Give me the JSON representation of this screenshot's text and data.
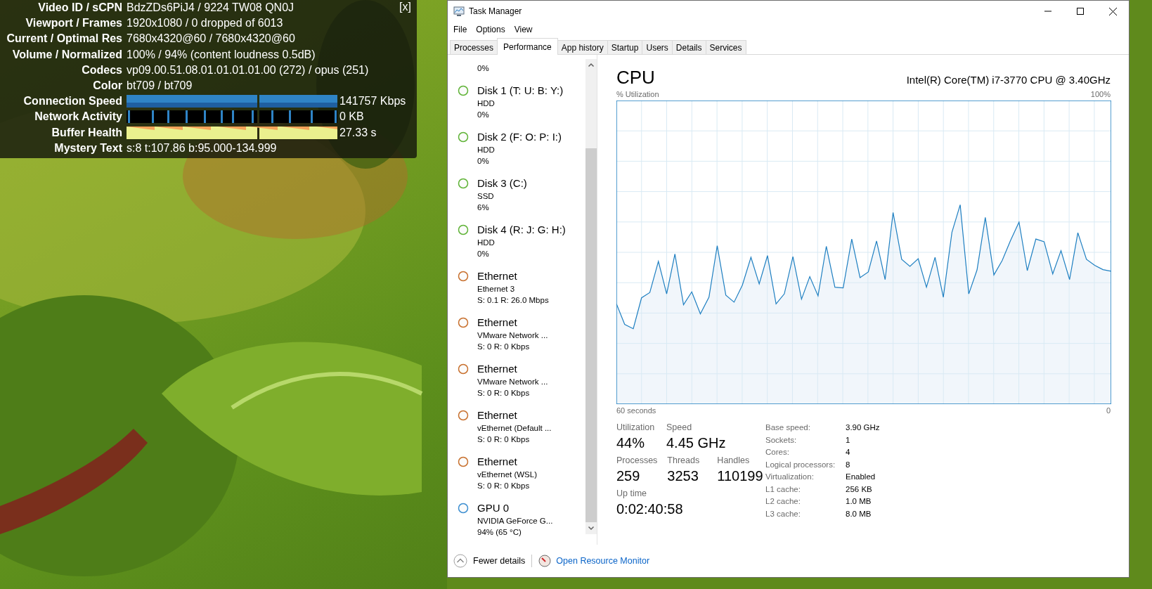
{
  "video_stats": {
    "close": "[x]",
    "rows": [
      {
        "label": "Video ID / sCPN",
        "kind": "text",
        "value": "BdzZDs6PiJ4 / 9224 TW08 QN0J"
      },
      {
        "label": "Viewport / Frames",
        "kind": "text",
        "value": "1920x1080 / 0 dropped of 6013"
      },
      {
        "label": "Current / Optimal Res",
        "kind": "text",
        "value": "7680x4320@60 / 7680x4320@60"
      },
      {
        "label": "Volume / Normalized",
        "kind": "text",
        "value": "100% / 94% (content loudness 0.5dB)"
      },
      {
        "label": "Codecs",
        "kind": "text",
        "value": "vp09.00.51.08.01.01.01.01.00 (272) / opus (251)"
      },
      {
        "label": "Color",
        "kind": "text",
        "value": "bt709 / bt709"
      },
      {
        "label": "Connection Speed",
        "kind": "speed_graph",
        "value": "141757 Kbps"
      },
      {
        "label": "Network Activity",
        "kind": "activity_graph",
        "value": "0 KB"
      },
      {
        "label": "Buffer Health",
        "kind": "buffer_graph",
        "value": "27.33 s"
      },
      {
        "label": "Mystery Text",
        "kind": "text",
        "value": "s:8 t:107.86 b:95.000-134.999"
      }
    ]
  },
  "window": {
    "title": "Task Manager"
  },
  "menu": [
    "File",
    "Options",
    "View"
  ],
  "tabs": [
    {
      "label": "Processes",
      "selected": false
    },
    {
      "label": "Performance",
      "selected": true
    },
    {
      "label": "App history",
      "selected": false
    },
    {
      "label": "Startup",
      "selected": false
    },
    {
      "label": "Users",
      "selected": false
    },
    {
      "label": "Details",
      "selected": false
    },
    {
      "label": "Services",
      "selected": false
    }
  ],
  "sidebar": {
    "items": [
      {
        "detail": "0%"
      },
      {
        "title": "Disk 1 (T: U: B: Y:)",
        "subtitle": "HDD",
        "detail": "0%",
        "color": "#5fb336"
      },
      {
        "title": "Disk 2 (F: O: P: I:)",
        "subtitle": "HDD",
        "detail": "0%",
        "color": "#5fb336"
      },
      {
        "title": "Disk 3 (C:)",
        "subtitle": "SSD",
        "detail": "6%",
        "color": "#5fb336"
      },
      {
        "title": "Disk 4 (R: J: G: H:)",
        "subtitle": "HDD",
        "detail": "0%",
        "color": "#5fb336"
      },
      {
        "title": "Ethernet",
        "subtitle": "Ethernet 3",
        "detail": "S: 0.1 R: 26.0 Mbps",
        "color": "#c8702e"
      },
      {
        "title": "Ethernet",
        "subtitle": "VMware Network ...",
        "detail": "S: 0 R: 0 Kbps",
        "color": "#c8702e"
      },
      {
        "title": "Ethernet",
        "subtitle": "VMware Network ...",
        "detail": "S: 0 R: 0 Kbps",
        "color": "#c8702e"
      },
      {
        "title": "Ethernet",
        "subtitle": "vEthernet (Default ...",
        "detail": "S: 0 R: 0 Kbps",
        "color": "#c8702e"
      },
      {
        "title": "Ethernet",
        "subtitle": "vEthernet (WSL)",
        "detail": "S: 0 R: 0 Kbps",
        "color": "#c8702e"
      },
      {
        "title": "GPU 0",
        "subtitle": "NVIDIA GeForce G...",
        "detail": "94%  (65 °C)",
        "color": "#3d8fd1"
      }
    ]
  },
  "performance": {
    "title": "CPU",
    "model": "Intel(R) Core(TM) i7-3770 CPU @ 3.40GHz",
    "graph": {
      "y_label": "% Utilization",
      "y_max": "100%",
      "x_start": "60 seconds",
      "x_end": "0"
    },
    "stat_rows": [
      [
        {
          "label": "Utilization",
          "value": "44%"
        },
        {
          "label": "Speed",
          "value": "4.45 GHz"
        }
      ],
      [
        {
          "label": "Processes",
          "value": "259"
        },
        {
          "label": "Threads",
          "value": "3253"
        },
        {
          "label": "Handles",
          "value": "110199"
        }
      ],
      [
        {
          "label": "Up time",
          "value": "0:02:40:58"
        }
      ]
    ],
    "specs": [
      {
        "label": "Base speed:",
        "value": "3.90 GHz"
      },
      {
        "label": "Sockets:",
        "value": "1"
      },
      {
        "label": "Cores:",
        "value": "4"
      },
      {
        "label": "Logical processors:",
        "value": "8"
      },
      {
        "label": "Virtualization:",
        "value": "Enabled"
      },
      {
        "label": "L1 cache:",
        "value": "256 KB"
      },
      {
        "label": "L2 cache:",
        "value": "1.0 MB"
      },
      {
        "label": "L3 cache:",
        "value": "8.0 MB"
      }
    ]
  },
  "footer": {
    "fewer_details": "Fewer details",
    "resource_monitor": "Open Resource Monitor"
  }
}
